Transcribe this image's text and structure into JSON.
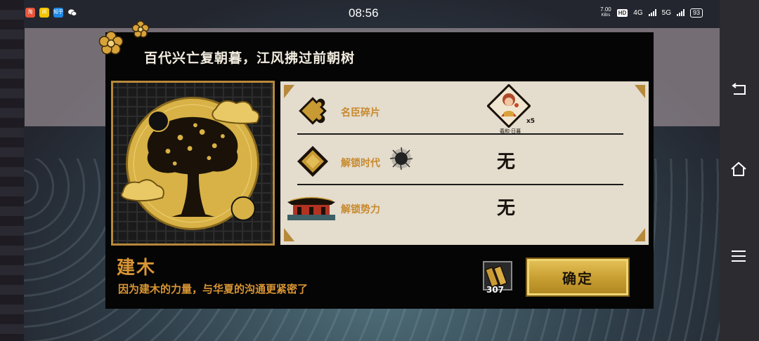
{
  "status_bar": {
    "time": "08:56",
    "apps": [
      {
        "name": "app-red",
        "color": "#e8553a",
        "label": "淘"
      },
      {
        "name": "app-yellow",
        "color": "#f2c500",
        "label": "闲"
      },
      {
        "name": "app-blue",
        "color": "#1e88e5",
        "label": "知乎"
      },
      {
        "name": "app-wechat",
        "color": "#2f2f2f",
        "label": ""
      }
    ],
    "net_speed": "7.00",
    "net_unit": "KB/s",
    "hd_label": "HD",
    "network_1": "4G",
    "network_2": "5G",
    "battery": "93"
  },
  "modal": {
    "title": "百代兴亡复朝暮，江风拂过前朝树",
    "skill_name": "建木",
    "skill_desc": "因为建木的力量，与华夏的沟通更紧密了",
    "rows": [
      {
        "label": "名臣碎片",
        "icon": "puzzle-icon"
      },
      {
        "label": "解锁时代",
        "icon": "diamond-gem-icon"
      },
      {
        "label": "解锁势力",
        "icon": "palace-icon"
      }
    ],
    "hero": {
      "count": "x5",
      "name": "羲和·日暮"
    },
    "unlock_era_value": "无",
    "unlock_faction_value": "无",
    "cost_count": "307",
    "confirm_label": "确定"
  },
  "colors": {
    "accent_gold": "#c78a2e",
    "panel_bg": "#e4dccd",
    "modal_bg": "#050505",
    "button_gold": "#c9a033"
  }
}
